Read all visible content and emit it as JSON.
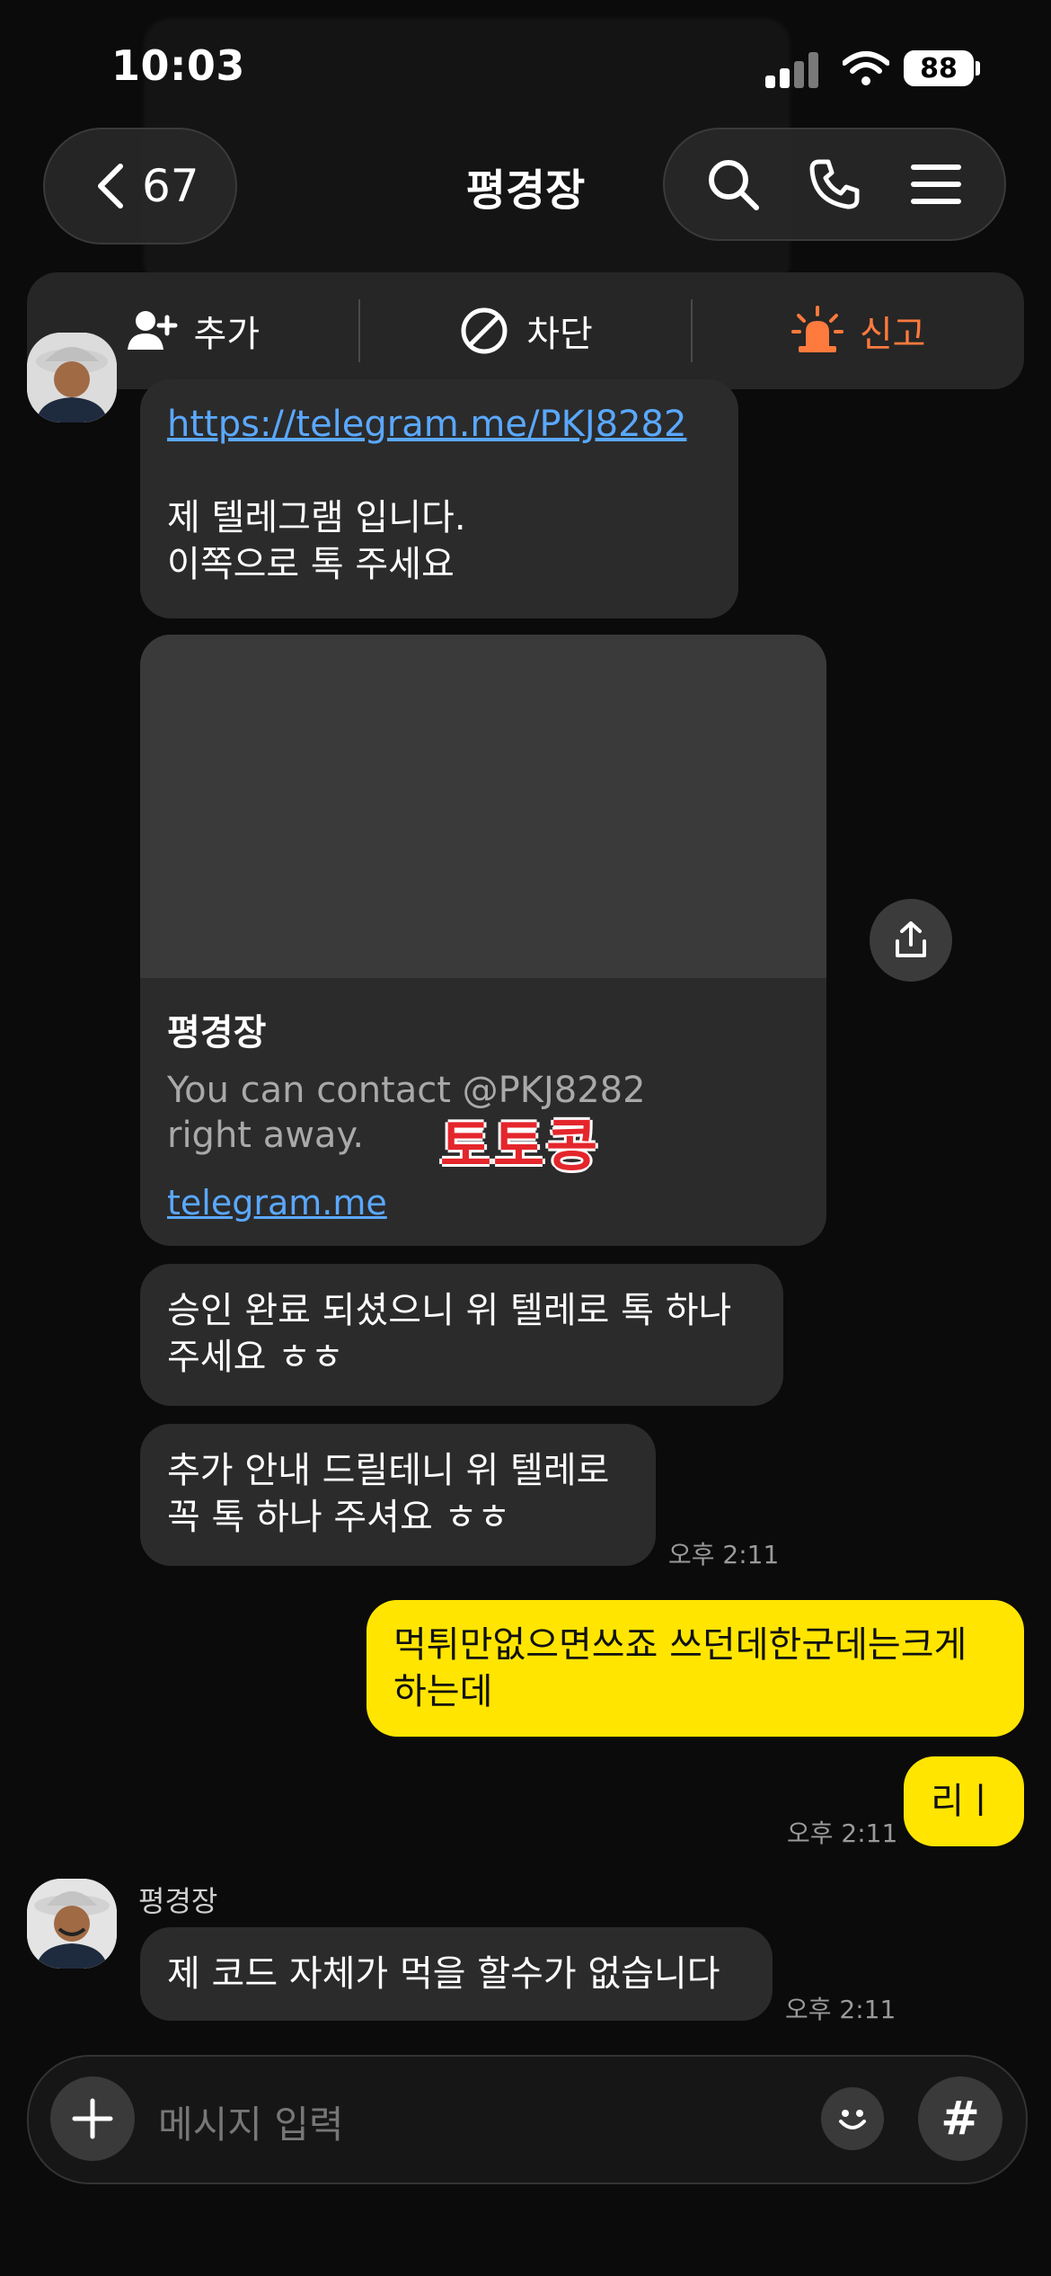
{
  "status_bar": {
    "time": "10:03",
    "battery": "88"
  },
  "header": {
    "back_count": "67",
    "title": "평경장"
  },
  "action_bar": {
    "add_label": "추가",
    "block_label": "차단",
    "report_label": "신고"
  },
  "messages": [
    {
      "link": "https://telegram.me/PKJ8282",
      "line1": "제 텔레그램 입니다.",
      "line2": "이쪽으로 톡 주세요"
    },
    {
      "line1": "승인 완료 되셨으니 위 텔레로 톡 하나",
      "line2": "주세요 ㅎㅎ"
    },
    {
      "line1": "추가 안내 드릴테니 위 텔레로",
      "line2": "꼭 톡 하나 주셔요  ㅎㅎ",
      "time": "오후 2:11"
    },
    {
      "line1": "먹튀만없으면쓰죠 쓰던데한군데는크게",
      "line2": "하는데"
    },
    {
      "text": "리ㅣ",
      "time": "오후 2:11"
    },
    {
      "sender": "평경장",
      "text": "제 코드 자체가 먹을 할수가 없습니다",
      "time": "오후 2:11"
    }
  ],
  "link_card": {
    "title": "평경장",
    "desc_line1": "You can contact @PKJ8282",
    "desc_line2": "right away.",
    "url": "telegram.me"
  },
  "watermark": "토토콩",
  "input": {
    "placeholder": "메시지 입력",
    "hash": "#"
  },
  "colors": {
    "my_bubble": "#ffe500",
    "report": "#ff7a3d",
    "link": "#5aa8ff"
  }
}
